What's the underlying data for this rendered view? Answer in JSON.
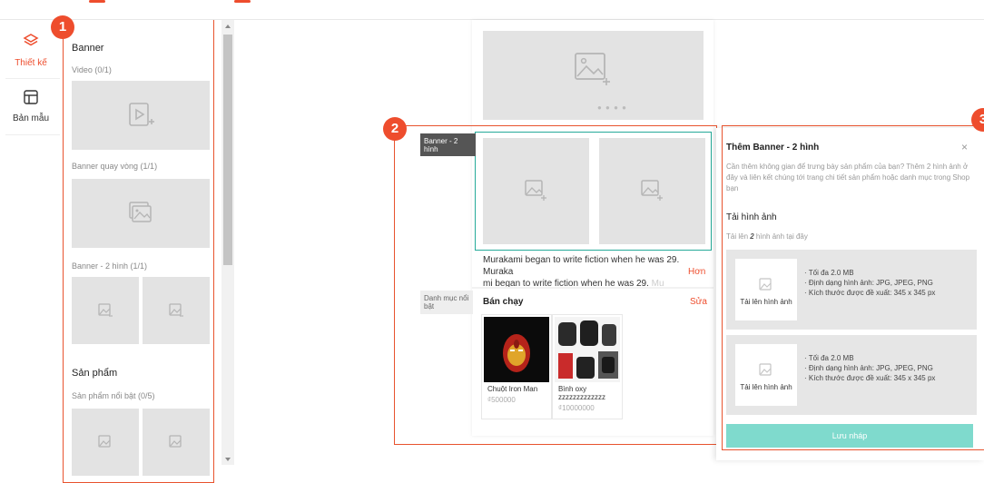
{
  "rail": {
    "design_label": "Thiết kế",
    "templates_label": "Bản mẫu"
  },
  "badges": [
    "1",
    "2",
    "3"
  ],
  "panel": {
    "section_banner": "Banner",
    "video_label": "Video (0/1)",
    "carousel_label": "Banner quay vòng (1/1)",
    "banner2_label": "Banner - 2 hình (1/1)",
    "section_products": "Sản phẩm",
    "featured_label": "Sản phẩm nổi bật (0/5)"
  },
  "preview": {
    "carousel_dots": "● ● ● ●",
    "banner2_tag": "Banner - 2 hình",
    "description": "Murakami began to write fiction when he was 29. Murakami began to write fiction when he was 29.",
    "description_line1": "Murakami began to write fiction when he was 29. Muraka",
    "description_line2": "mi began to write fiction when he was 29.",
    "description_fade": "Mu",
    "more_label": "Hơn",
    "featured_tag": "Danh mục nổi bật",
    "bestseller_title": "Bán chạy",
    "edit_label": "Sửa",
    "products": [
      {
        "name": "Chuột Iron Man",
        "price": "₫500000"
      },
      {
        "name": "Bình oxy zzzzzzzzzzzzz",
        "price": "₫10000000"
      }
    ]
  },
  "settings": {
    "title": "Thêm Banner - 2 hình",
    "close": "×",
    "description": "Cần thêm không gian để trưng bày sản phẩm của bạn? Thêm 2 hình ảnh ở đây và liên kết chúng tới trang chi tiết sản phẩm hoặc danh mục trong Shop bạn",
    "upload_heading": "Tải hình ảnh",
    "upload_hint_pre": "Tải lên ",
    "upload_hint_num": "2",
    "upload_hint_post": " hình ảnh tại đây",
    "upload_label": "Tải lên hình ảnh",
    "specs": [
      "Tối đa 2.0 MB",
      "Định dạng hình ảnh: JPG, JPEG, PNG",
      "Kích thước được đề xuất: 345 x 345 px"
    ],
    "save_label": "Lưu nháp"
  },
  "colors": {
    "accent": "#ee4d2d",
    "teal": "#26aa99",
    "save_button": "#7fdacd"
  }
}
